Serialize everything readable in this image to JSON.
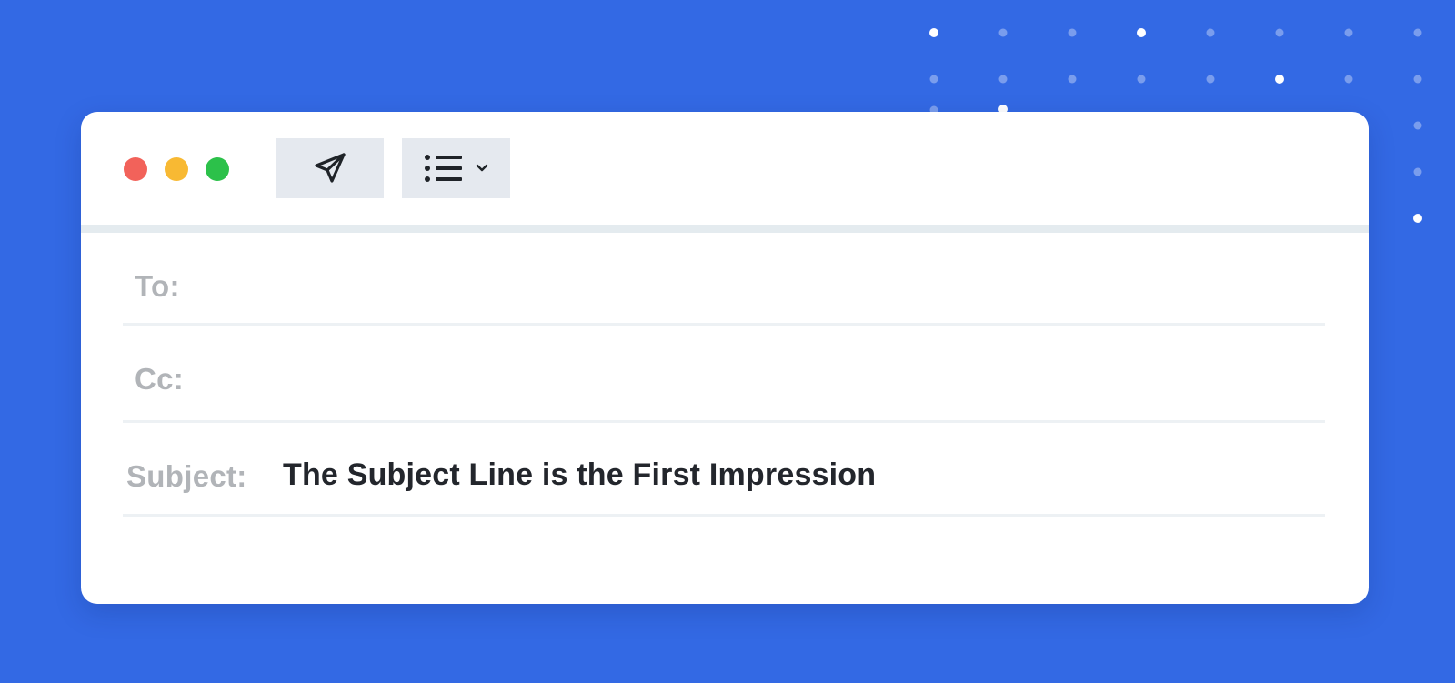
{
  "colors": {
    "background": "#3369e4",
    "window": "#ffffff",
    "traffic_red": "#f2625a",
    "traffic_yellow": "#f8b933",
    "traffic_green": "#2cc14a",
    "toolbar_button": "#e5e9ef",
    "label_text": "#b1b4b8",
    "value_text": "#23262c"
  },
  "toolbar": {
    "send_icon": "paper-plane-icon",
    "format_icon": "bulleted-list-icon",
    "dropdown_icon": "chevron-down-icon"
  },
  "fields": {
    "to": {
      "label": "To:",
      "value": ""
    },
    "cc": {
      "label": "Cc:",
      "value": ""
    },
    "subject": {
      "label": "Subject:",
      "value": "The Subject Line is the First Impression"
    }
  }
}
